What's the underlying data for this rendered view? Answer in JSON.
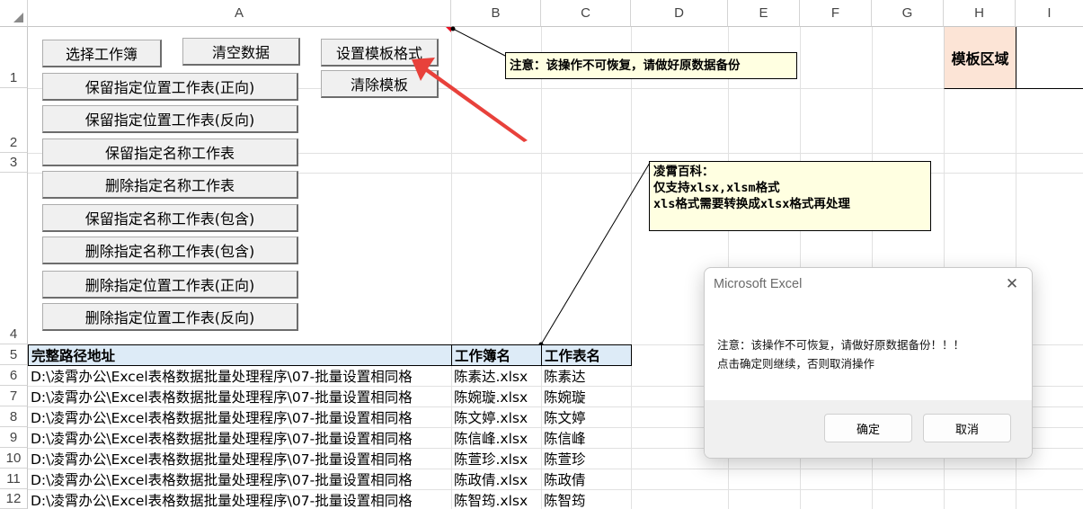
{
  "columns": [
    "A",
    "B",
    "C",
    "D",
    "E",
    "F",
    "G",
    "H",
    "I"
  ],
  "rows": [
    "1",
    "2",
    "3",
    "4",
    "5",
    "6",
    "7",
    "8",
    "9",
    "10",
    "11",
    "12"
  ],
  "buttons": {
    "select_workbook": "选择工作簿",
    "clear_data": "清空数据",
    "set_template_format": "设置模板格式",
    "clear_template": "清除模板",
    "keep_pos_forward": "保留指定位置工作表(正向)",
    "keep_pos_reverse": "保留指定位置工作表(反向)",
    "keep_name": "保留指定名称工作表",
    "delete_name": "删除指定名称工作表",
    "keep_name_contains": "保留指定名称工作表(包含)",
    "delete_name_contains": "删除指定名称工作表(包含)",
    "delete_pos_forward": "删除指定位置工作表(正向)",
    "delete_pos_reverse": "删除指定位置工作表(反向)"
  },
  "template_region": "模板区域",
  "comments": {
    "warning": "注意：该操作不可恢复，请做好原数据备份",
    "info_line1": "凌霄百科：",
    "info_line2": "仅支持xlsx,xlsm格式",
    "info_line3": "xls格式需要转换成xlsx格式再处理"
  },
  "table": {
    "headers": [
      "完整路径地址",
      "工作簿名",
      "工作表名"
    ],
    "rows": [
      {
        "path": "D:\\凌霄办公\\Excel表格数据批量处理程序\\07-批量设置相同格",
        "book": "陈素达.xlsx",
        "sheet": "陈素达"
      },
      {
        "path": "D:\\凌霄办公\\Excel表格数据批量处理程序\\07-批量设置相同格",
        "book": "陈婉璇.xlsx",
        "sheet": "陈婉璇"
      },
      {
        "path": "D:\\凌霄办公\\Excel表格数据批量处理程序\\07-批量设置相同格",
        "book": "陈文婷.xlsx",
        "sheet": "陈文婷"
      },
      {
        "path": "D:\\凌霄办公\\Excel表格数据批量处理程序\\07-批量设置相同格",
        "book": "陈信峰.xlsx",
        "sheet": "陈信峰"
      },
      {
        "path": "D:\\凌霄办公\\Excel表格数据批量处理程序\\07-批量设置相同格",
        "book": "陈萱珍.xlsx",
        "sheet": "陈萱珍"
      },
      {
        "path": "D:\\凌霄办公\\Excel表格数据批量处理程序\\07-批量设置相同格",
        "book": "陈政倩.xlsx",
        "sheet": "陈政倩"
      },
      {
        "path": "D:\\凌霄办公\\Excel表格数据批量处理程序\\07-批量设置相同格",
        "book": "陈智筠.xlsx",
        "sheet": "陈智筠"
      }
    ]
  },
  "dialog": {
    "title": "Microsoft Excel",
    "message_line1": "注意：该操作不可恢复，请做好原数据备份！！！",
    "message_line2": "点击确定则继续，否则取消操作",
    "ok": "确定",
    "cancel": "取消"
  },
  "colors": {
    "header_fill": "#ddebf7",
    "template_fill": "#fce4d6",
    "comment_fill": "#ffffe1",
    "arrow": "#e8413b"
  }
}
